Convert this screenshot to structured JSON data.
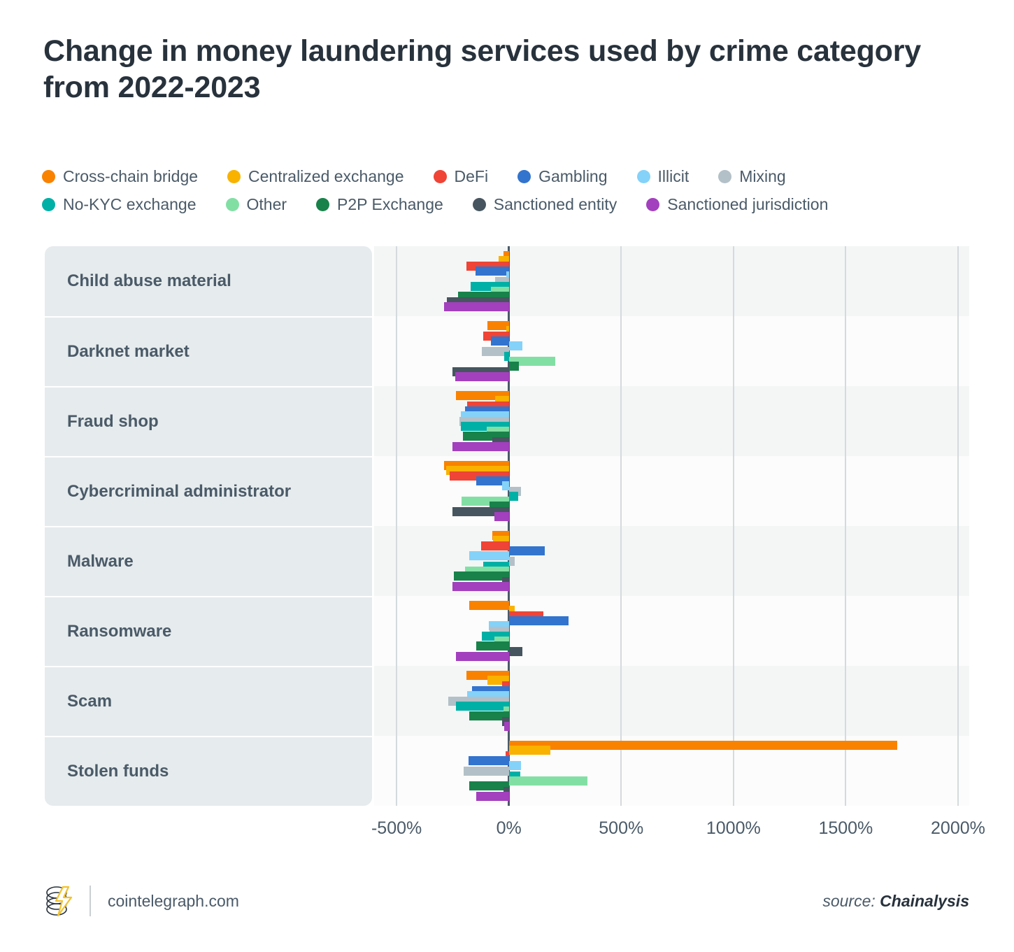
{
  "title": "Change in money laundering services used by crime category from 2022-2023",
  "footer": {
    "site": "cointelegraph.com",
    "source_prefix": "source: ",
    "source_name": "Chainalysis",
    "logo_icon": "cointelegraph-logo-icon"
  },
  "legend": [
    {
      "label": "Cross-chain bridge",
      "color": "#f98200"
    },
    {
      "label": "Centralized exchange",
      "color": "#f9b200"
    },
    {
      "label": "DeFi",
      "color": "#ef4436"
    },
    {
      "label": "Gambling",
      "color": "#3274ce"
    },
    {
      "label": "Illicit",
      "color": "#84d2f9"
    },
    {
      "label": "Mixing",
      "color": "#b3c0c7"
    },
    {
      "label": "No-KYC exchange",
      "color": "#00b0a6"
    },
    {
      "label": "Other",
      "color": "#82dfa4"
    },
    {
      "label": "P2P Exchange",
      "color": "#18824a"
    },
    {
      "label": "Sanctioned entity",
      "color": "#46555f"
    },
    {
      "label": "Sanctioned jurisdiction",
      "color": "#a340be"
    }
  ],
  "chart_data": {
    "type": "bar",
    "orientation": "horizontal",
    "title": "Change in money laundering services used by crime category from 2022-2023",
    "xlabel": "",
    "ylabel": "",
    "xlim": [
      -600,
      2050
    ],
    "xticks": [
      -500,
      0,
      500,
      1000,
      1500,
      2000
    ],
    "xticklabels": [
      "-500%",
      "0%",
      "500%",
      "1000%",
      "1500%",
      "2000%"
    ],
    "grid": true,
    "legend_position": "top",
    "unit": "%",
    "categories": [
      "Child abuse material",
      "Darknet market",
      "Fraud shop",
      "Cybercriminal administrator",
      "Malware",
      "Ransomware",
      "Scam",
      "Stolen funds"
    ],
    "series": [
      {
        "name": "Cross-chain bridge",
        "color": "#f98200",
        "values": [
          -25,
          -95,
          -235,
          -290,
          -75,
          -175,
          -190,
          1730
        ]
      },
      {
        "name": "Centralized exchange",
        "color": "#f9b200",
        "values": [
          -45,
          -10,
          -60,
          -280,
          -70,
          25,
          -95,
          185
        ]
      },
      {
        "name": "DeFi",
        "color": "#ef4436",
        "values": [
          -190,
          -115,
          -185,
          -265,
          -125,
          155,
          -30,
          -15
        ]
      },
      {
        "name": "Gambling",
        "color": "#3274ce",
        "values": [
          -150,
          -80,
          -195,
          -145,
          160,
          265,
          -165,
          -180
        ]
      },
      {
        "name": "Illicit",
        "color": "#84d2f9",
        "values": [
          -10,
          60,
          -215,
          -30,
          -175,
          -90,
          -185,
          55
        ]
      },
      {
        "name": "Mixing",
        "color": "#b3c0c7",
        "values": [
          -60,
          -120,
          -220,
          55,
          25,
          -85,
          -270,
          -200
        ]
      },
      {
        "name": "No-KYC exchange",
        "color": "#00b0a6",
        "values": [
          -170,
          -20,
          -215,
          40,
          -115,
          -120,
          -235,
          50
        ]
      },
      {
        "name": "Other",
        "color": "#82dfa4",
        "values": [
          -80,
          205,
          -100,
          -210,
          -195,
          -65,
          -25,
          350
        ]
      },
      {
        "name": "P2P Exchange",
        "color": "#18824a",
        "values": [
          -225,
          45,
          -205,
          -85,
          -245,
          -145,
          -175,
          -175
        ]
      },
      {
        "name": "Sanctioned entity",
        "color": "#46555f",
        "values": [
          -275,
          -250,
          -75,
          -250,
          -30,
          60,
          -30,
          -25
        ]
      },
      {
        "name": "Sanctioned jurisdiction",
        "color": "#a340be",
        "values": [
          -290,
          -240,
          -250,
          -65,
          -250,
          -235,
          -20,
          -145
        ]
      }
    ]
  }
}
